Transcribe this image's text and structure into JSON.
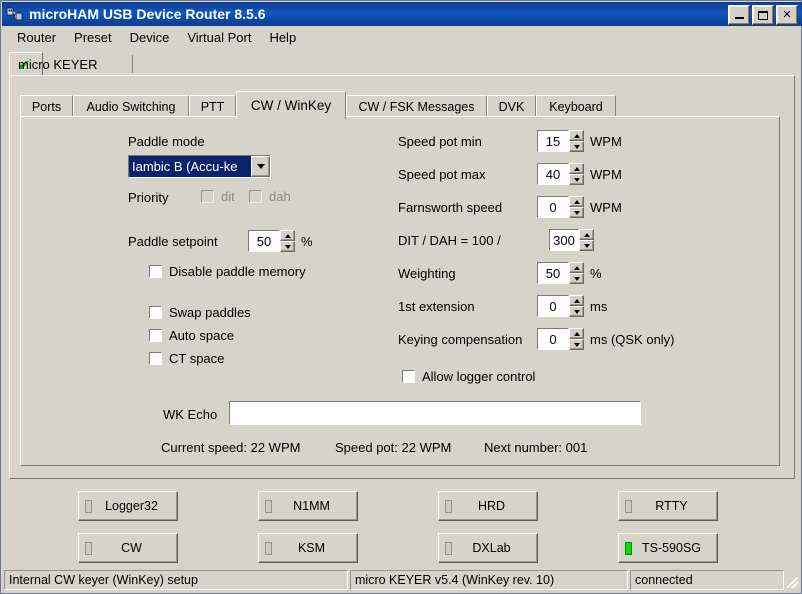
{
  "window": {
    "title": "microHAM USB Device Router 8.5.6",
    "icon": "usb-plug-icon",
    "minimize_label": "_",
    "maximize_label": "□",
    "close_label": "✕"
  },
  "menubar": {
    "items": [
      {
        "label": "Router"
      },
      {
        "label": "Preset"
      },
      {
        "label": "Device"
      },
      {
        "label": "Virtual Port"
      },
      {
        "label": "Help"
      }
    ]
  },
  "device_tab": {
    "label": "micro KEYER",
    "check": "✔"
  },
  "tabs": [
    {
      "label": "Ports",
      "active": false
    },
    {
      "label": "Audio Switching",
      "active": false
    },
    {
      "label": "PTT",
      "active": false
    },
    {
      "label": "CW / WinKey",
      "active": true
    },
    {
      "label": "CW / FSK Messages",
      "active": false
    },
    {
      "label": "DVK",
      "active": false
    },
    {
      "label": "Keyboard",
      "active": false
    }
  ],
  "cw_winkey": {
    "paddle_mode_label": "Paddle mode",
    "paddle_mode_value": "Iambic B  (Accu-ke",
    "priority_label": "Priority",
    "priority_dit_label": "dit",
    "priority_dah_label": "dah",
    "priority_dit_checked": false,
    "priority_dah_checked": false,
    "paddle_setpoint_label": "Paddle setpoint",
    "paddle_setpoint_value": "50",
    "paddle_setpoint_unit": "%",
    "disable_paddle_memory_label": "Disable paddle memory",
    "disable_paddle_memory_checked": false,
    "swap_paddles_label": "Swap paddles",
    "swap_paddles_checked": false,
    "auto_space_label": "Auto space",
    "auto_space_checked": false,
    "ct_space_label": "CT space",
    "ct_space_checked": false,
    "speed_pot_min_label": "Speed pot min",
    "speed_pot_min_value": "15",
    "speed_pot_min_unit": "WPM",
    "speed_pot_max_label": "Speed pot max",
    "speed_pot_max_value": "40",
    "speed_pot_max_unit": "WPM",
    "farnsworth_label": "Farnsworth speed",
    "farnsworth_value": "0",
    "farnsworth_unit": "WPM",
    "ditdah_label": "DIT / DAH =  100 /",
    "ditdah_value": "300",
    "weighting_label": "Weighting",
    "weighting_value": "50",
    "weighting_unit": "%",
    "extension_label": "1st extension",
    "extension_value": "0",
    "extension_unit": "ms",
    "keying_comp_label": "Keying compensation",
    "keying_comp_value": "0",
    "keying_comp_unit": "ms (QSK only)",
    "allow_logger_label": "Allow logger control",
    "allow_logger_checked": false,
    "wk_echo_label": "WK Echo",
    "wk_echo_value": "",
    "current_speed": "Current speed: 22 WPM",
    "speed_pot": "Speed pot: 22 WPM",
    "next_number": "Next number:   001"
  },
  "app_buttons": [
    {
      "label": "Logger32",
      "led_on": false
    },
    {
      "label": "N1MM",
      "led_on": false
    },
    {
      "label": "HRD",
      "led_on": false
    },
    {
      "label": "RTTY",
      "led_on": false
    },
    {
      "label": "CW",
      "led_on": false
    },
    {
      "label": "KSM",
      "led_on": false
    },
    {
      "label": "DXLab",
      "led_on": false
    },
    {
      "label": "TS-590SG",
      "led_on": true
    }
  ],
  "statusbar": {
    "left": "Internal CW keyer (WinKey) setup",
    "middle": "micro KEYER v5.4 (WinKey rev. 10)",
    "right": "connected"
  },
  "colors": {
    "face": "#d6d3ca",
    "titlebar": "#0c3d91",
    "selection": "#0a246a",
    "led_on": "#00e000",
    "check": "#00a800"
  }
}
